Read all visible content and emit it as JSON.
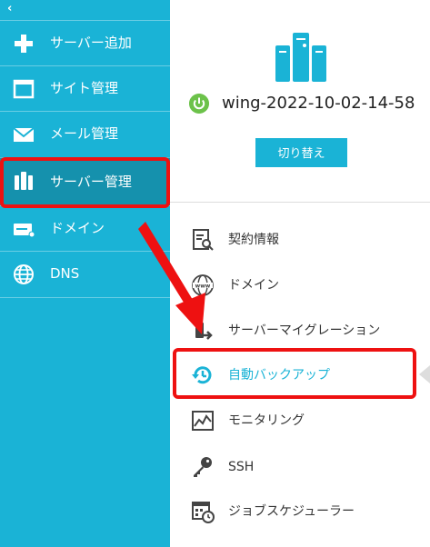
{
  "sidebar": {
    "collapse_glyph": "‹",
    "items": [
      {
        "label": "サーバー追加",
        "icon": "plus-icon"
      },
      {
        "label": "サイト管理",
        "icon": "window-icon"
      },
      {
        "label": "メール管理",
        "icon": "envelope-icon"
      },
      {
        "label": "サーバー管理",
        "icon": "server-icon"
      },
      {
        "label": "ドメイン",
        "icon": "domain-card-icon"
      },
      {
        "label": "DNS",
        "icon": "globe-icon"
      }
    ]
  },
  "server": {
    "name": "wing-2022-10-02-14-58",
    "status": "power-on",
    "switch_label": "切り替え"
  },
  "menu": {
    "items": [
      {
        "label": "契約情報",
        "icon": "contract-icon"
      },
      {
        "label": "ドメイン",
        "icon": "www-globe-icon"
      },
      {
        "label": "サーバーマイグレーション",
        "icon": "migration-icon"
      },
      {
        "label": "自動バックアップ",
        "icon": "backup-clock-icon"
      },
      {
        "label": "モニタリング",
        "icon": "monitoring-icon"
      },
      {
        "label": "SSH",
        "icon": "key-icon"
      },
      {
        "label": "ジョブスケジューラー",
        "icon": "calendar-clock-icon"
      }
    ]
  },
  "colors": {
    "accent": "#1ab3d6",
    "highlight": "#ee1111",
    "power": "#6cc24a"
  }
}
